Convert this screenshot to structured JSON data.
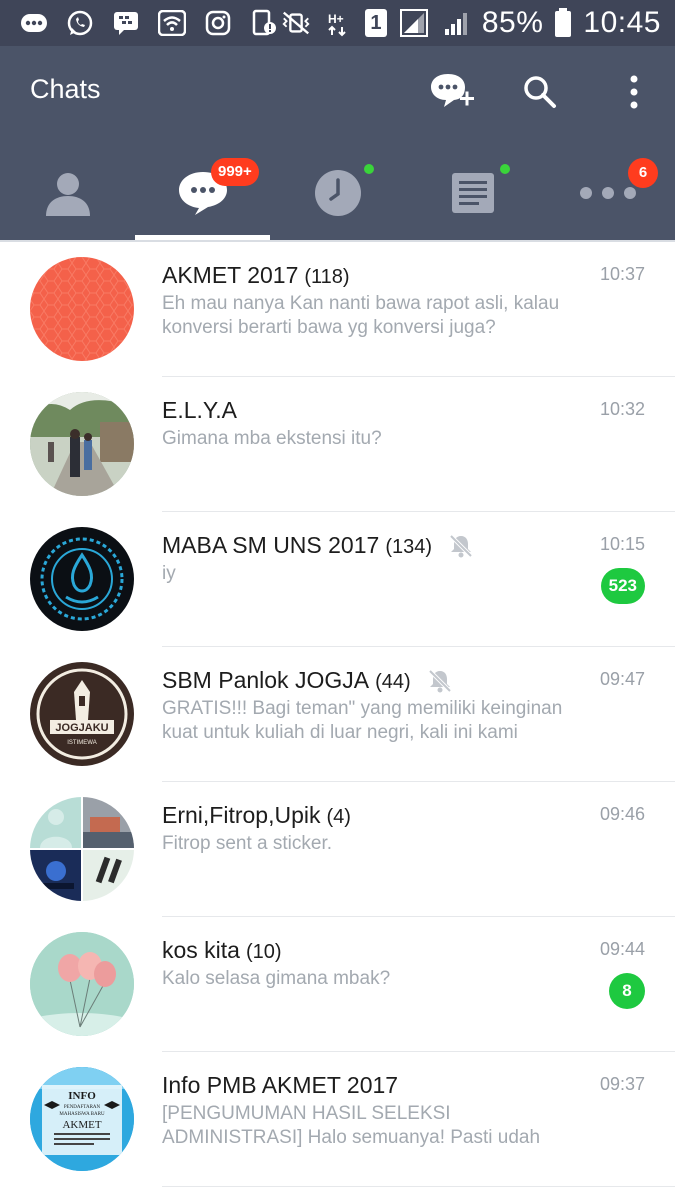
{
  "status_bar": {
    "battery_percent": "85%",
    "time": "10:45",
    "sim_slot": "1"
  },
  "header": {
    "title": "Chats"
  },
  "tabs": {
    "chats_badge": "999+",
    "more_badge": "6",
    "active": "chats"
  },
  "chats": [
    {
      "name": "AKMET 2017",
      "count": "(118)",
      "time": "10:37",
      "message": "Eh mau nanya Kan nanti bawa rapot asli, kalau konversi berarti bawa yg konversi juga?",
      "muted": false,
      "unread": ""
    },
    {
      "name": "E.L.Y.A",
      "count": "",
      "time": "10:32",
      "message": "Gimana mba ekstensi itu?",
      "muted": false,
      "unread": ""
    },
    {
      "name": "MABA SM UNS 2017",
      "count": "(134)",
      "time": "10:15",
      "message": "iy",
      "muted": true,
      "unread": "523"
    },
    {
      "name": "SBM Panlok JOGJA",
      "count": "(44)",
      "time": "09:47",
      "message": "GRATIS!!! Bagi teman\" yang memiliki keinginan kuat untuk kuliah di luar negri, kali ini kami",
      "muted": true,
      "unread": ""
    },
    {
      "name": "Erni,Fitrop,Upik",
      "count": "(4)",
      "time": "09:46",
      "message": "Fitrop sent a sticker.",
      "muted": false,
      "unread": ""
    },
    {
      "name": "kos kita",
      "count": "(10)",
      "time": "09:44",
      "message": "Kalo selasa gimana mbak?",
      "muted": false,
      "unread": "8"
    },
    {
      "name": "Info PMB AKMET 2017",
      "count": "",
      "time": "09:37",
      "message": "[PENGUMUMAN HASIL SELEKSI ADMINISTRASI] Halo semuanya! Pasti udah",
      "muted": false,
      "unread": ""
    }
  ],
  "avatar_texts": {
    "sbm_logo": "JOGJAKU",
    "sbm_logo_sub": "ISTIMEWA",
    "info_line1": "INFO",
    "info_line2": "PENDAFTARAN",
    "info_line3": "MAHASISWA BARU",
    "info_line4": "AKMET"
  },
  "colors": {
    "status_bar": "#3f4558",
    "header": "#4b5468",
    "badge_red": "#ff3c1e",
    "badge_green": "#1ec940",
    "online_dot": "#3ad43a"
  }
}
